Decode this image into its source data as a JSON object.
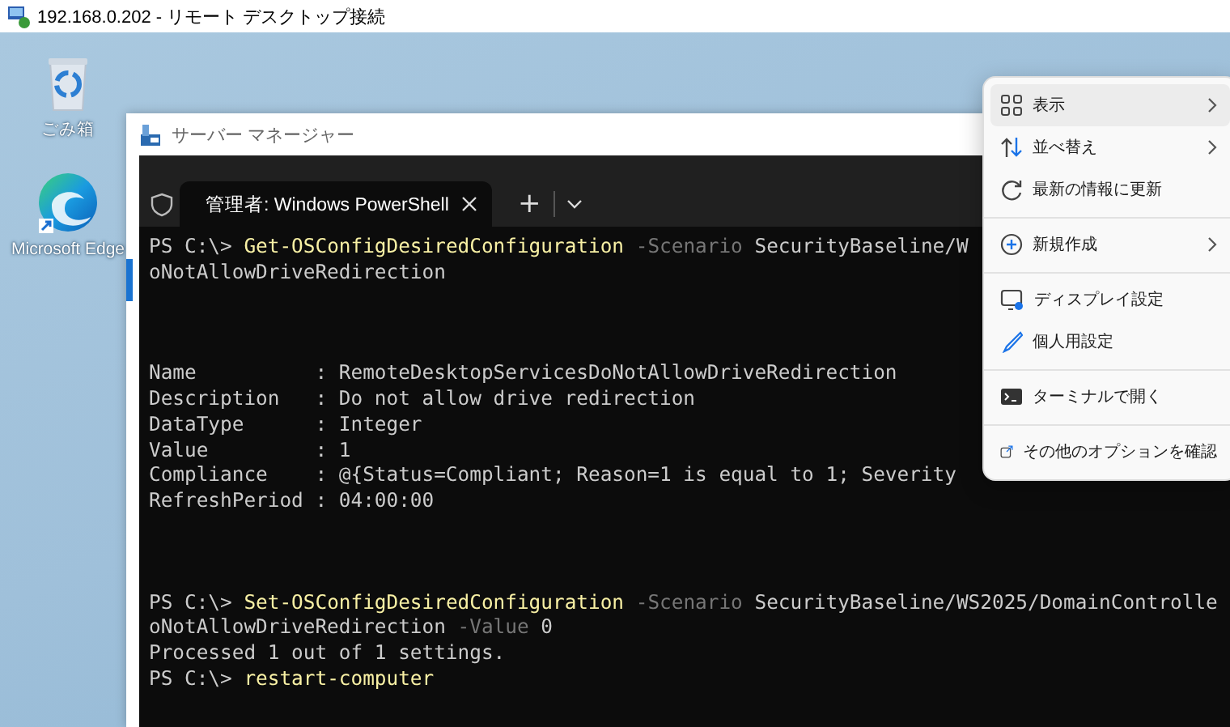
{
  "window": {
    "title": "192.168.0.202 - リモート デスクトップ接続"
  },
  "desktop_icons": [
    {
      "label": "ごみ箱",
      "kind": "recycle"
    },
    {
      "label": "Microsoft Edge",
      "kind": "edge"
    }
  ],
  "server_manager": {
    "title": "サーバー マネージャー"
  },
  "terminal": {
    "tabs": [
      {
        "label": "管理者: Windows PowerShell",
        "selected": true
      }
    ],
    "new_tab": "+",
    "blocks": [
      {
        "kind": "command",
        "lines": [
          [
            {
              "kind": "prompt",
              "text": "PS C:\\> "
            },
            {
              "kind": "command",
              "text": "Get-OSConfigDesiredConfiguration"
            },
            {
              "kind": "parameter",
              "text": " -Scenario"
            },
            {
              "kind": "argument",
              "text": " SecurityBaseline/W"
            }
          ],
          [
            {
              "kind": "argument",
              "text": "oNotAllowDriveRedirection"
            }
          ]
        ]
      },
      {
        "kind": "output",
        "lines": [
          [
            {
              "kind": "output",
              "text": "Name          : RemoteDesktopServicesDoNotAllowDriveRedirection"
            }
          ],
          [
            {
              "kind": "output",
              "text": "Description   : Do not allow drive redirection"
            }
          ],
          [
            {
              "kind": "output",
              "text": "DataType      : Integer"
            }
          ],
          [
            {
              "kind": "output",
              "text": "Value         : 1"
            }
          ],
          [
            {
              "kind": "output",
              "text": "Compliance    : @{Status=Compliant; Reason=1 is equal to 1; Severity"
            }
          ],
          [
            {
              "kind": "output",
              "text": "RefreshPeriod : 04:00:00"
            }
          ]
        ]
      },
      {
        "kind": "command",
        "lines": [
          [
            {
              "kind": "prompt",
              "text": "PS C:\\> "
            },
            {
              "kind": "command",
              "text": "Set-OSConfigDesiredConfiguration"
            },
            {
              "kind": "parameter",
              "text": " -Scenario"
            },
            {
              "kind": "argument",
              "text": " SecurityBaseline/WS2025/DomainControlle"
            }
          ],
          [
            {
              "kind": "argument",
              "text": "oNotAllowDriveRedirection"
            },
            {
              "kind": "parameter",
              "text": " -Value"
            },
            {
              "kind": "argument",
              "text": " 0"
            }
          ],
          [
            {
              "kind": "output",
              "text": "Processed 1 out of 1 settings."
            }
          ],
          [
            {
              "kind": "prompt",
              "text": "PS C:\\> "
            },
            {
              "kind": "command",
              "text": "restart-computer"
            }
          ]
        ]
      }
    ]
  },
  "context_menu": {
    "items": [
      {
        "label": "表示",
        "kind": "grid",
        "submenu": true,
        "highlighted": true,
        "separator_before": false
      },
      {
        "label": "並べ替え",
        "kind": "sort",
        "submenu": true,
        "highlighted": false,
        "separator_before": false
      },
      {
        "label": "最新の情報に更新",
        "kind": "refresh",
        "submenu": false,
        "highlighted": false,
        "separator_before": false
      },
      {
        "label": "新規作成",
        "kind": "plus",
        "submenu": true,
        "highlighted": false,
        "separator_before": true
      },
      {
        "label": "ディスプレイ設定",
        "kind": "display",
        "submenu": false,
        "highlighted": false,
        "separator_before": true
      },
      {
        "label": "個人用設定",
        "kind": "brush",
        "submenu": false,
        "highlighted": false,
        "separator_before": false
      },
      {
        "label": "ターミナルで開く",
        "kind": "terminal",
        "submenu": false,
        "highlighted": false,
        "separator_before": true
      },
      {
        "label": "その他のオプションを確認",
        "kind": "external",
        "submenu": false,
        "highlighted": false,
        "separator_before": true
      }
    ]
  }
}
